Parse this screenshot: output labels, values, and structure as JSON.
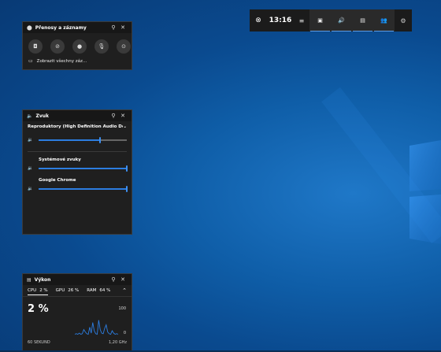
{
  "capture": {
    "title": "Přenosy a záznamy",
    "show_all": "Zobrazit všechny záz...",
    "icons": [
      "camera-icon",
      "record-last-icon",
      "record-icon",
      "mic-off-icon",
      "broadcast-icon"
    ]
  },
  "sound": {
    "title": "Zvuk",
    "device": "Reproduktory (High Definition Audio Devi...",
    "master_volume": 0.7,
    "apps": [
      {
        "name": "Systémové zvuky",
        "volume": 1.0
      },
      {
        "name": "Google Chrome",
        "volume": 1.0
      }
    ]
  },
  "perf": {
    "title": "Výkon",
    "tabs": [
      {
        "label": "CPU",
        "value": "2 %"
      },
      {
        "label": "GPU",
        "value": "26 %"
      },
      {
        "label": "RAM",
        "value": "64 %"
      }
    ],
    "big_value": "2 %",
    "axis_max": "100",
    "axis_min": "0",
    "footer_left": "60 SEKUND",
    "footer_right": "1,20 GHz",
    "series": [
      2,
      3,
      2,
      4,
      2,
      3,
      10,
      6,
      3,
      2,
      14,
      4,
      22,
      8,
      3,
      2,
      26,
      10,
      4,
      3,
      12,
      18,
      6,
      3,
      2,
      8,
      4,
      2,
      3,
      2
    ]
  },
  "gamebar": {
    "time": "13:16"
  }
}
